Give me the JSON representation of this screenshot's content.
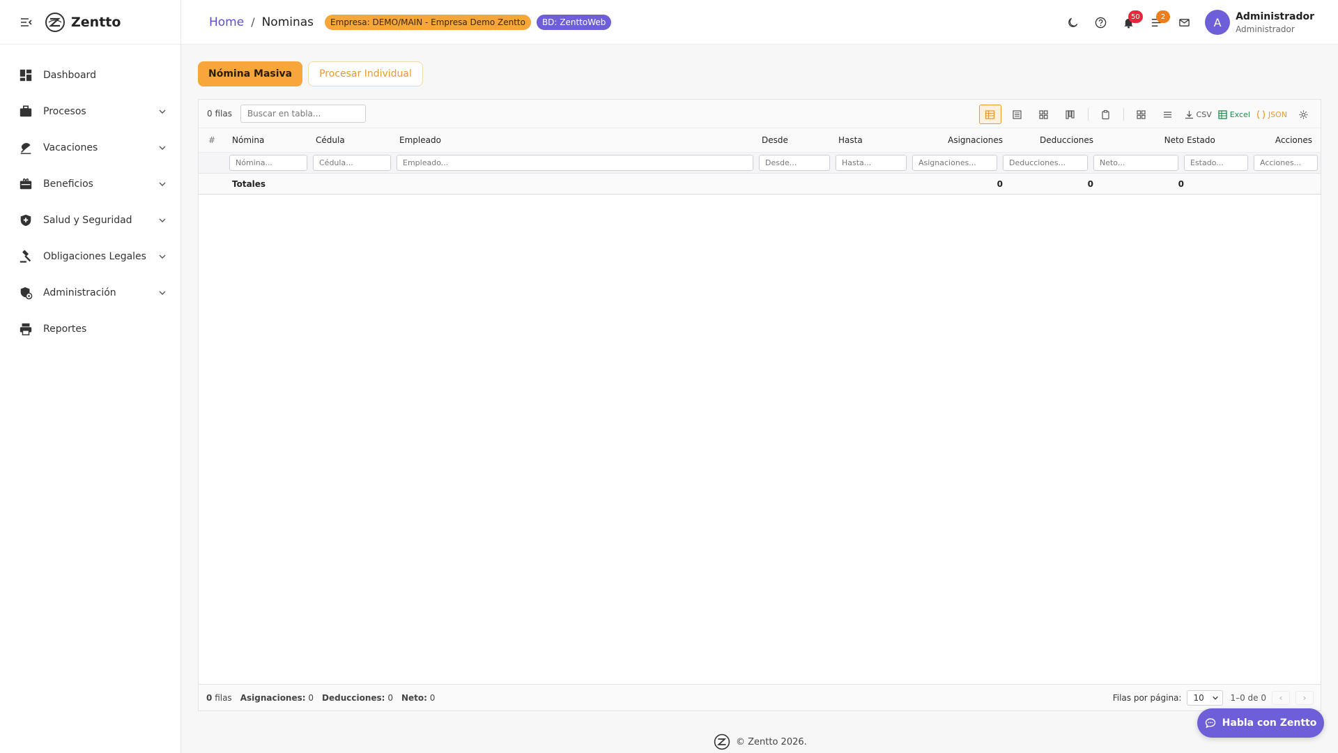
{
  "app": {
    "name": "Zentto"
  },
  "sidebar": {
    "items": [
      {
        "label": "Dashboard",
        "icon": "dashboard-icon",
        "has_children": false
      },
      {
        "label": "Procesos",
        "icon": "briefcase-icon",
        "has_children": true
      },
      {
        "label": "Vacaciones",
        "icon": "beach-icon",
        "has_children": true
      },
      {
        "label": "Beneficios",
        "icon": "card-giftcard-icon",
        "has_children": true
      },
      {
        "label": "Salud y Seguridad",
        "icon": "shield-icon",
        "has_children": true
      },
      {
        "label": "Obligaciones Legales",
        "icon": "gavel-icon",
        "has_children": true
      },
      {
        "label": "Administración",
        "icon": "admin-icon",
        "has_children": true
      },
      {
        "label": "Reportes",
        "icon": "printer-icon",
        "has_children": false
      }
    ]
  },
  "header": {
    "breadcrumb": {
      "home": "Home",
      "separator": "/",
      "current": "Nominas"
    },
    "empresa_badge": "Empresa: DEMO/MAIN - Empresa Demo Zentto",
    "bd_badge": "BD: ZenttoWeb",
    "notifications_count": "50",
    "tasks_count": "2",
    "user": {
      "avatar_letter": "A",
      "name": "Administrador",
      "role": "Administrador"
    }
  },
  "tabs": [
    {
      "label": "Nómina Masiva",
      "active": true
    },
    {
      "label": "Procesar Individual",
      "active": false
    }
  ],
  "grid": {
    "rows_label": "0 filas",
    "search_placeholder": "Buscar en tabla...",
    "toolbar": {
      "csv_label": "CSV",
      "excel_label": "Excel",
      "json_label": "JSON"
    },
    "columns": [
      "#",
      "Nómina",
      "Cédula",
      "Empleado",
      "Desde",
      "Hasta",
      "Asignaciones",
      "Deducciones",
      "Neto",
      "Estado",
      "Acciones"
    ],
    "filters": [
      "Nómina...",
      "Cédula...",
      "Empleado...",
      "Desde...",
      "Hasta...",
      "Asignaciones...",
      "Deducciones...",
      "Neto...",
      "Estado...",
      "Acciones..."
    ],
    "totals": {
      "label": "Totales",
      "asignaciones": "0",
      "deducciones": "0",
      "neto": "0"
    },
    "footer": {
      "rows_count": "0",
      "rows_word": "filas",
      "asignaciones_label": "Asignaciones:",
      "asignaciones_value": "0",
      "deducciones_label": "Deducciones:",
      "deducciones_value": "0",
      "neto_label": "Neto:",
      "neto_value": "0",
      "per_page_label": "Filas por página:",
      "per_page_value": "10",
      "range": "1–0 de 0",
      "prev": "‹",
      "next": "›"
    }
  },
  "copyright": "© Zentto 2026.",
  "chat_button": "Habla con Zentto",
  "colors": {
    "primary": "#6c5fd8",
    "accent": "#f7a73a",
    "danger": "#e5283c",
    "excel": "#1e8a4a"
  }
}
